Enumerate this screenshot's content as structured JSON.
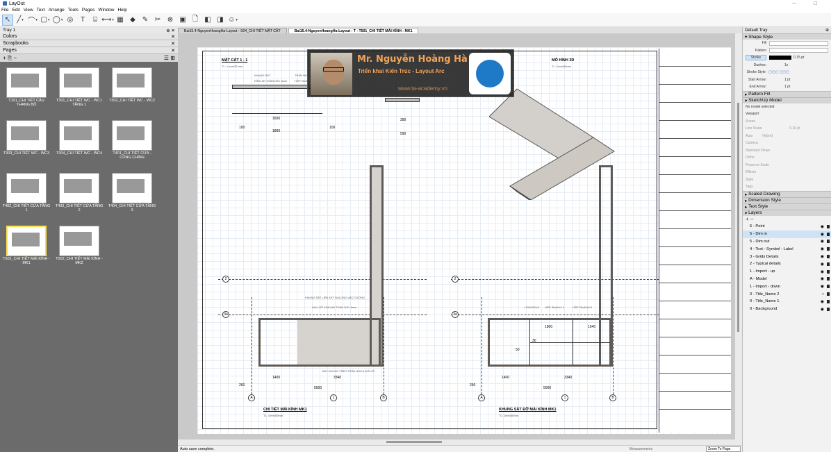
{
  "app": {
    "title": "LayOut"
  },
  "menu": [
    "File",
    "Edit",
    "View",
    "Text",
    "Arrange",
    "Tools",
    "Pages",
    "Window",
    "Help"
  ],
  "tray": {
    "title": "Tray 1",
    "panels": [
      "Colors",
      "Scrapbooks",
      "Pages"
    ],
    "pages": [
      {
        "label": "T101_CHI TIẾT CẦU THANG BỘ"
      },
      {
        "label": "T301_CHI TIẾT WC - WC1 TẦNG 1"
      },
      {
        "label": "T302_CHI TIẾT WC - WC2"
      },
      {
        "label": "T303_CHI TIẾT WC - WC3"
      },
      {
        "label": "T304_CHI TIẾT WC - WC4"
      },
      {
        "label": "T401_CHI TIẾT CỬA - CỔNG CHÍNH"
      },
      {
        "label": "T402_CHI TIẾT CỬA TẦNG 1"
      },
      {
        "label": "T403_CHI TIẾT CỬA TẦNG 2"
      },
      {
        "label": "T404_CHI TIẾT CỬA TẦNG 3"
      },
      {
        "label": "T501_CHI TIẾT MÁI KÍNH - MK1"
      },
      {
        "label": "T502_CHI TIẾT MÁI KÍNH - MK2"
      }
    ]
  },
  "tabs": [
    {
      "label": "Bai15.4-NguyenHoangHa-Layout - S04_CHI TIẾT MẶT CẮT"
    },
    {
      "label": "Bai15.4-NguyenHoangHa-Layout - T - T501_CHI TIẾT MÁI KÍNH - MK1"
    }
  ],
  "drawing": {
    "section_title": "MẶT CẮT 1 - 1",
    "section_scale": "TL: 1 mm/25 mm",
    "model_title": "MÔ HÌNH 3D",
    "model_scale": "TL: 1mm/50mm",
    "plan1_title": "CHI TIẾT MÁI KÍNH MK1",
    "plan1_scale": "TL: 1mm/50mm",
    "plan2_title": "KHUNG SẮT ĐỠ MÁI KÍNH MK1",
    "plan2_scale": "TL: 1mm/50mm",
    "notes": {
      "n1": "KHUNG SẮT",
      "n2": "KÍNH AN TOÀN DÀY 8mm",
      "n3": "TRẦN NHỰA",
      "n4": "HỘP 20x40",
      "n5": "KHUNG SẮT LIÊN KẾT BULONG VÀO TƯỜNG",
      "n6": "HAI LỚP KÍNH AN TOÀN DÀY 8mm",
      "n7": "BAY KHUNG TREO TRẦN NHỰA GIẢ GỖ",
      "n8": "I 100x200x3",
      "n9": "HỘP 30x60x1.4",
      "n10": "HỘP 20x40x0.9"
    },
    "dims": {
      "d1600": "1600",
      "d1800": "1800",
      "d100a": "100",
      "d100b": "100",
      "d390": "390",
      "d590": "590",
      "d5000a": "5000",
      "d1400a": "1400",
      "d3340a": "3340",
      "d260a": "260",
      "d5000b": "5000",
      "d1400b": "1400",
      "d3340b": "3340",
      "d260b": "260",
      "d1800b": "1800",
      "d1540": "1540",
      "d50": "50",
      "d30": "30"
    },
    "axes": {
      "a2": "2",
      "a3": "3a",
      "a1": "1",
      "aA": "A",
      "aB": "B",
      "a2b": "2",
      "a3b": "3a",
      "a1b": "1",
      "aAb": "A",
      "aBb": "B"
    }
  },
  "overlay": {
    "name": "Mr. Nguyễn Hoàng Hà",
    "subtitle": "Triển khai Kiến Trúc - Layout Arc",
    "website": "www.ta-academy.vn"
  },
  "right": {
    "tray": "Default Tray",
    "shape_style": "Shape Style",
    "fill": "Fill",
    "pattern": "Pattern",
    "stroke": "Stroke",
    "stroke_val": "0.15 pt",
    "dashes": "Dashes:",
    "dash_val": "1x",
    "stroke_style": "Stroke Style:",
    "start_arrow": "Start Arrow:",
    "start_val": "1 pt",
    "end_arrow": "End Arrow:",
    "end_val": "1 pt",
    "pattern_fill": "Pattern Fill",
    "sketchup_model": "SketchUp Model",
    "no_model": "No model selected",
    "viewport": "Viewport",
    "scene": "Scene",
    "line_scale": "Line Scale",
    "line_scale_val": "0.10 pt",
    "auto": "Auto",
    "hybrid": "Hybrid",
    "camera": "Camera",
    "standard_views": "Standard Views",
    "ortho": "Ortho",
    "preserve_scale": "Preserve Scale",
    "effects": "Effects",
    "style": "Style",
    "tags": "Tags",
    "scaled_drawing": "Scaled Drawing",
    "dimension_style": "Dimension Style",
    "text_style": "Text Style",
    "layers": "Layers",
    "layer_list": [
      {
        "name": "6 - Point"
      },
      {
        "name": "5 - Dim in"
      },
      {
        "name": "5 - Dim out"
      },
      {
        "name": "4 - Text - Symbol - Label"
      },
      {
        "name": "3 - Grids Details"
      },
      {
        "name": "2 - Typical details"
      },
      {
        "name": "1 - Import - up"
      },
      {
        "name": "A - Model"
      },
      {
        "name": "1 - Import - down"
      },
      {
        "name": "0 - Title_Name 2"
      },
      {
        "name": "0 - Title_Name 1"
      },
      {
        "name": "0 - Background"
      }
    ]
  },
  "status": {
    "message": "Auto save complete.",
    "measurements": "Measurements",
    "zoom": "Zoom To Page"
  }
}
